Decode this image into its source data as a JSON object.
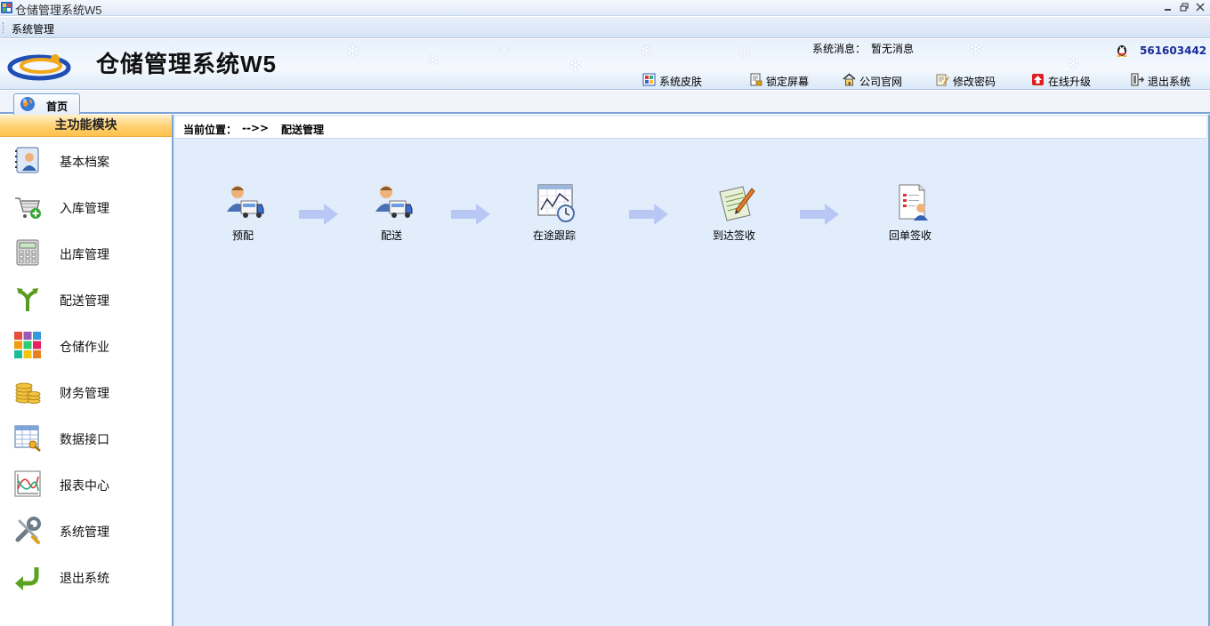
{
  "window": {
    "title": "仓储管理系统W5"
  },
  "menu": {
    "items": [
      "系统管理"
    ]
  },
  "header": {
    "app_title": "仓储管理系统W5",
    "sys_msg_label": "系统消息：",
    "sys_msg_value": "暂无消息",
    "qq_number": "561603442",
    "toolbar": [
      {
        "label": "系统皮肤",
        "icon": "skin-icon"
      },
      {
        "label": "锁定屏幕",
        "icon": "lock-screen-icon"
      },
      {
        "label": "公司官网",
        "icon": "home-icon"
      },
      {
        "label": "修改密码",
        "icon": "edit-password-icon"
      },
      {
        "label": "在线升级",
        "icon": "upgrade-icon"
      },
      {
        "label": "退出系统",
        "icon": "exit-icon"
      }
    ]
  },
  "tabs": [
    {
      "label": "首页",
      "icon": "home-globe-icon"
    }
  ],
  "sidebar": {
    "title": "主功能模块",
    "items": [
      {
        "label": "基本档案",
        "icon": "profile-book-icon"
      },
      {
        "label": "入库管理",
        "icon": "cart-add-icon"
      },
      {
        "label": "出库管理",
        "icon": "calculator-icon"
      },
      {
        "label": "配送管理",
        "icon": "fork-arrow-icon"
      },
      {
        "label": "仓储作业",
        "icon": "grid-blocks-icon"
      },
      {
        "label": "财务管理",
        "icon": "coins-icon"
      },
      {
        "label": "数据接口",
        "icon": "table-key-icon"
      },
      {
        "label": "报表中心",
        "icon": "chart-report-icon"
      },
      {
        "label": "系统管理",
        "icon": "tools-icon"
      },
      {
        "label": "退出系统",
        "icon": "return-arrow-icon"
      }
    ]
  },
  "breadcrumb": {
    "label": "当前位置：",
    "arrow": "-->>",
    "location": "配送管理"
  },
  "flow": [
    {
      "label": "预配",
      "icon": "user-truck-icon"
    },
    {
      "label": "配送",
      "icon": "user-truck-icon"
    },
    {
      "label": "在途跟踪",
      "icon": "chart-clock-icon"
    },
    {
      "label": "到达签收",
      "icon": "notepad-pen-icon"
    },
    {
      "label": "回单签收",
      "icon": "document-user-icon"
    }
  ],
  "colors": {
    "accent": "#7ea3d6",
    "panel_bg": "#e1edfb",
    "sidebar_header": "#ffd071",
    "arrow": "#b9c7f5"
  }
}
